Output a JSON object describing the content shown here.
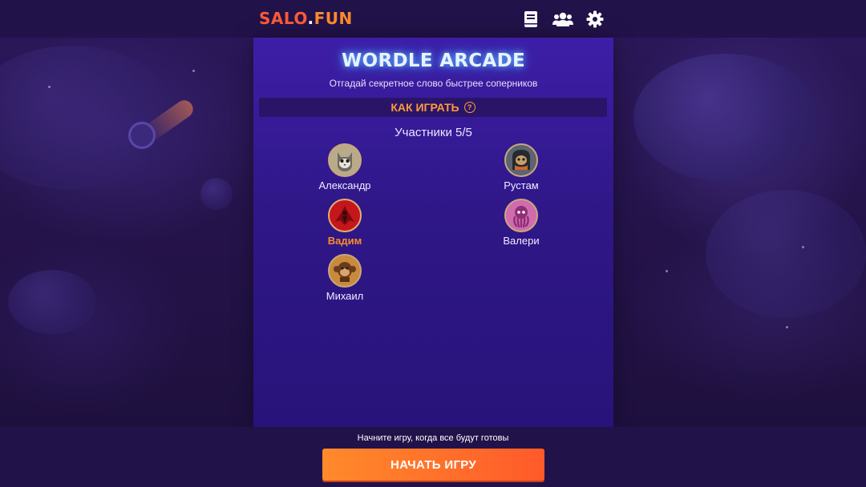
{
  "header": {
    "logo_part1": "SALO",
    "logo_dot": ".",
    "logo_part2": "FUN",
    "icons": [
      "book-icon",
      "users-icon",
      "gear-icon"
    ]
  },
  "game": {
    "title": "WORDLE ARCADE",
    "subtitle": "Отгадай секретное слово быстрее соперников",
    "how_to_play": "КАК ИГРАТЬ",
    "how_to_play_icon": "?",
    "participants_label": "Участники 5/5"
  },
  "players": [
    {
      "name": "Александр",
      "avatar": "cat-avatar",
      "current_user": false
    },
    {
      "name": "Рустам",
      "avatar": "penguin-avatar",
      "current_user": false
    },
    {
      "name": "Вадим",
      "avatar": "red-figure-avatar",
      "current_user": true
    },
    {
      "name": "Валери",
      "avatar": "octopus-avatar",
      "current_user": false
    },
    {
      "name": "Михаил",
      "avatar": "monkey-avatar",
      "current_user": false
    }
  ],
  "footer": {
    "hint": "Начните игру, когда все будут готовы",
    "start_button": "НАЧАТЬ ИГРУ"
  },
  "colors": {
    "accent_orange": "#ff8b2b",
    "logo_red": "#ff5a36",
    "panel": "#3d1ea7",
    "background": "#23124a"
  }
}
